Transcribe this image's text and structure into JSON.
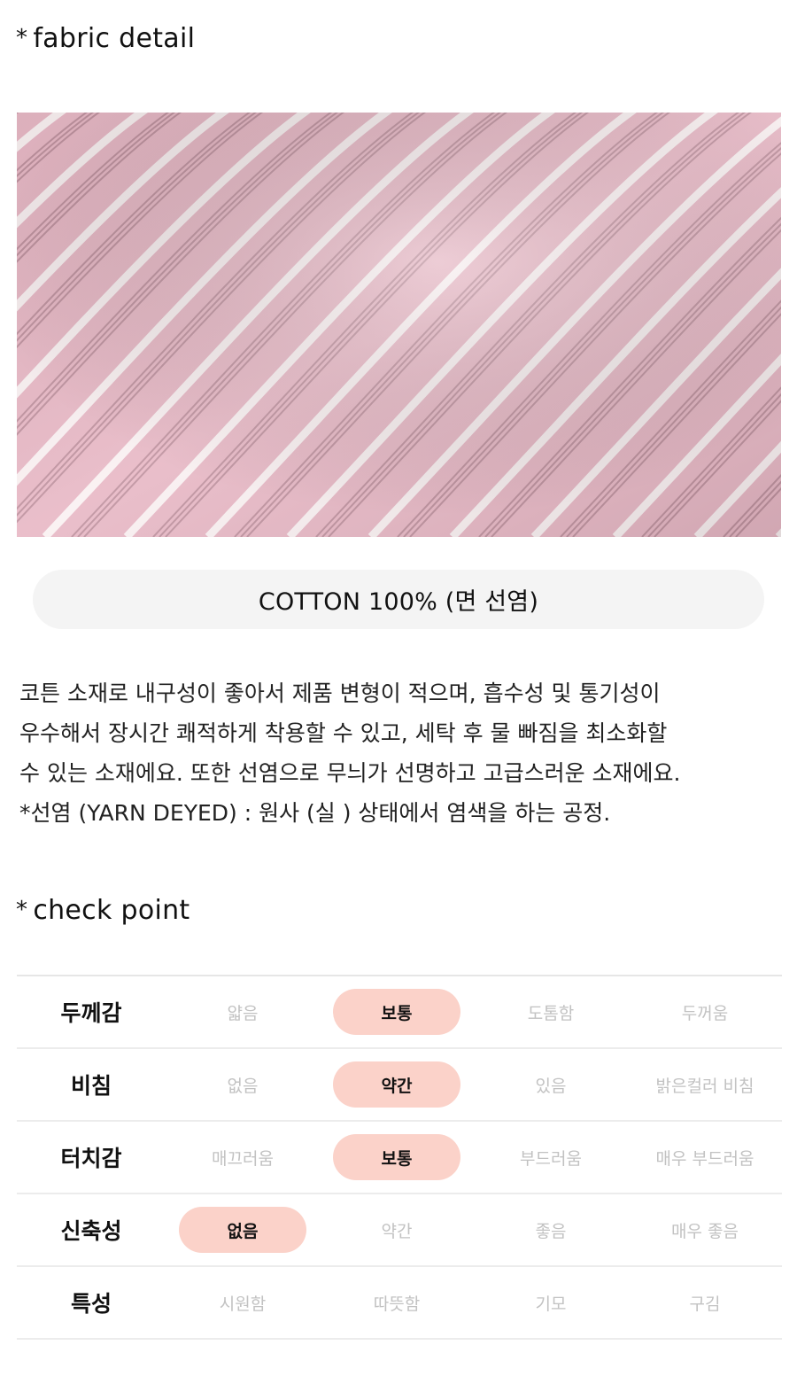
{
  "fabric_section": {
    "star": "*",
    "title": "fabric detail"
  },
  "fabric_photo": {
    "description": "",
    "colors": {
      "base": "#e8b9c6",
      "stripe_white": "#fbf3f4",
      "stripe_thin": "#b58a96"
    }
  },
  "material": {
    "label": "COTTON 100% (면 선염)"
  },
  "description_lines": [
    "코튼 소재로 내구성이 좋아서 제품 변형이 적으며, 흡수성 및 통기성이",
    "우수해서 장시간 쾌적하게 착용할 수 있고, 세탁 후 물 빠짐을 최소화할",
    "수 있는 소재에요. 또한 선염으로 무늬가 선명하고 고급스러운 소재에요.",
    "*선염 (YARN DEYED) : 원사 (실 ) 상태에서 염색을 하는 공정."
  ],
  "check_section": {
    "star": "*",
    "title": "check point"
  },
  "check_table": {
    "highlight_color": "#fbd2c9",
    "rows": [
      {
        "label": "두께감",
        "options": [
          "얇음",
          "보통",
          "도톰함",
          "두꺼움"
        ],
        "selected": 1
      },
      {
        "label": "비침",
        "options": [
          "없음",
          "약간",
          "있음",
          "밝은컬러 비침"
        ],
        "selected": 1
      },
      {
        "label": "터치감",
        "options": [
          "매끄러움",
          "보통",
          "부드러움",
          "매우 부드러움"
        ],
        "selected": 1
      },
      {
        "label": "신축성",
        "options": [
          "없음",
          "약간",
          "좋음",
          "매우 좋음"
        ],
        "selected": 0
      },
      {
        "label": "특성",
        "options": [
          "시원함",
          "따뜻함",
          "기모",
          "구김"
        ],
        "selected": -1
      }
    ]
  }
}
